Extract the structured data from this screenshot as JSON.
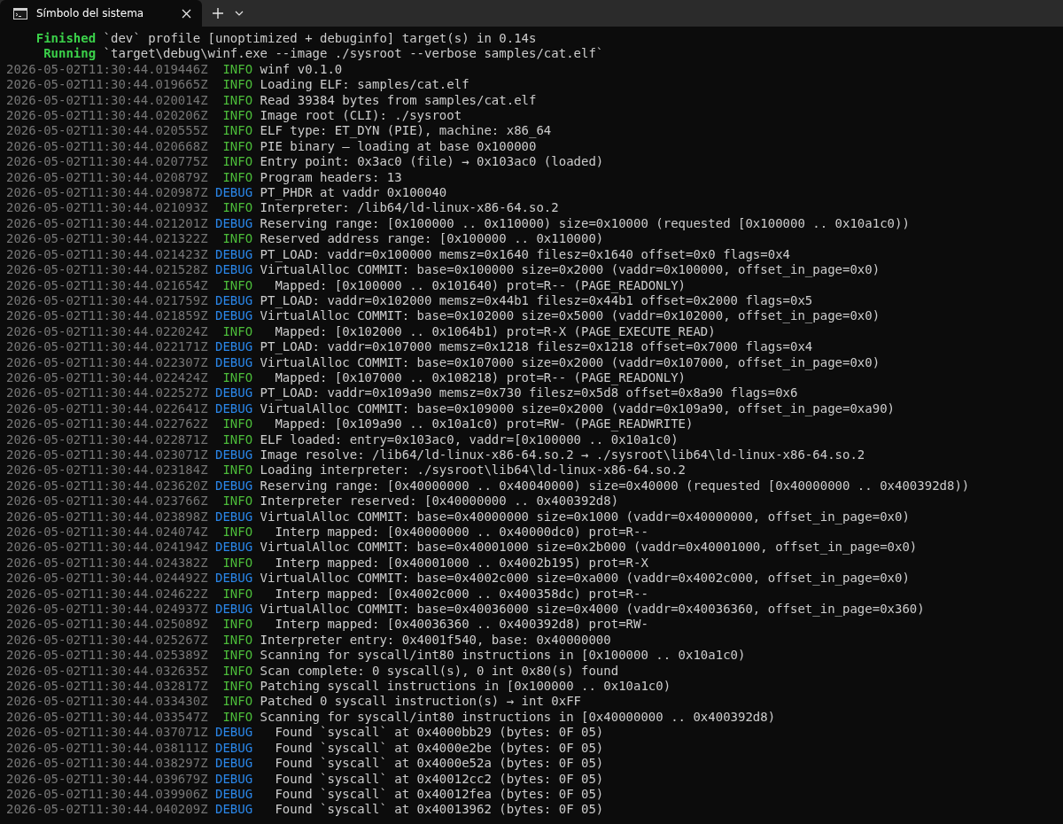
{
  "tabs": [
    {
      "title": "Símbolo del sistema",
      "selected": true
    }
  ],
  "cargo_lines": [
    {
      "status": "Finished",
      "message": "`dev` profile [unoptimized + debuginfo] target(s) in 0.14s"
    },
    {
      "status": "Running",
      "message": "`target\\debug\\winf.exe --image ./sysroot --verbose samples/cat.elf`"
    }
  ],
  "log_lines": [
    {
      "time": "2026-05-02T11:30:44.019446Z",
      "kind": "info",
      "severity": "INFO",
      "message": "winf v0.1.0"
    },
    {
      "time": "2026-05-02T11:30:44.019665Z",
      "kind": "info",
      "severity": "INFO",
      "message": "Loading ELF: samples/cat.elf"
    },
    {
      "time": "2026-05-02T11:30:44.020014Z",
      "kind": "info",
      "severity": "INFO",
      "message": "Read 39384 bytes from samples/cat.elf"
    },
    {
      "time": "2026-05-02T11:30:44.020206Z",
      "kind": "info",
      "severity": "INFO",
      "message": "Image root (CLI): ./sysroot"
    },
    {
      "time": "2026-05-02T11:30:44.020555Z",
      "kind": "info",
      "severity": "INFO",
      "message": "ELF type: ET_DYN (PIE), machine: x86_64"
    },
    {
      "time": "2026-05-02T11:30:44.020668Z",
      "kind": "info",
      "severity": "INFO",
      "message": "PIE binary – loading at base 0x100000"
    },
    {
      "time": "2026-05-02T11:30:44.020775Z",
      "kind": "info",
      "severity": "INFO",
      "message": "Entry point: 0x3ac0 (file) → 0x103ac0 (loaded)"
    },
    {
      "time": "2026-05-02T11:30:44.020879Z",
      "kind": "info",
      "severity": "INFO",
      "message": "Program headers: 13"
    },
    {
      "time": "2026-05-02T11:30:44.020987Z",
      "kind": "debug",
      "severity": "DEBUG",
      "message": "PT_PHDR at vaddr 0x100040"
    },
    {
      "time": "2026-05-02T11:30:44.021093Z",
      "kind": "info",
      "severity": "INFO",
      "message": "Interpreter: /lib64/ld-linux-x86-64.so.2"
    },
    {
      "time": "2026-05-02T11:30:44.021201Z",
      "kind": "debug",
      "severity": "DEBUG",
      "message": "Reserving range: [0x100000 .. 0x110000) size=0x10000 (requested [0x100000 .. 0x10a1c0))"
    },
    {
      "time": "2026-05-02T11:30:44.021322Z",
      "kind": "info",
      "severity": "INFO",
      "message": "Reserved address range: [0x100000 .. 0x110000)"
    },
    {
      "time": "2026-05-02T11:30:44.021423Z",
      "kind": "debug",
      "severity": "DEBUG",
      "message": "PT_LOAD: vaddr=0x100000 memsz=0x1640 filesz=0x1640 offset=0x0 flags=0x4"
    },
    {
      "time": "2026-05-02T11:30:44.021528Z",
      "kind": "debug",
      "severity": "DEBUG",
      "message": "VirtualAlloc COMMIT: base=0x100000 size=0x2000 (vaddr=0x100000, offset_in_page=0x0)"
    },
    {
      "time": "2026-05-02T11:30:44.021654Z",
      "kind": "info",
      "severity": "INFO",
      "message": "  Mapped: [0x100000 .. 0x101640) prot=R-- (PAGE_READONLY)"
    },
    {
      "time": "2026-05-02T11:30:44.021759Z",
      "kind": "debug",
      "severity": "DEBUG",
      "message": "PT_LOAD: vaddr=0x102000 memsz=0x44b1 filesz=0x44b1 offset=0x2000 flags=0x5"
    },
    {
      "time": "2026-05-02T11:30:44.021859Z",
      "kind": "debug",
      "severity": "DEBUG",
      "message": "VirtualAlloc COMMIT: base=0x102000 size=0x5000 (vaddr=0x102000, offset_in_page=0x0)"
    },
    {
      "time": "2026-05-02T11:30:44.022024Z",
      "kind": "info",
      "severity": "INFO",
      "message": "  Mapped: [0x102000 .. 0x1064b1) prot=R-X (PAGE_EXECUTE_READ)"
    },
    {
      "time": "2026-05-02T11:30:44.022171Z",
      "kind": "debug",
      "severity": "DEBUG",
      "message": "PT_LOAD: vaddr=0x107000 memsz=0x1218 filesz=0x1218 offset=0x7000 flags=0x4"
    },
    {
      "time": "2026-05-02T11:30:44.022307Z",
      "kind": "debug",
      "severity": "DEBUG",
      "message": "VirtualAlloc COMMIT: base=0x107000 size=0x2000 (vaddr=0x107000, offset_in_page=0x0)"
    },
    {
      "time": "2026-05-02T11:30:44.022424Z",
      "kind": "info",
      "severity": "INFO",
      "message": "  Mapped: [0x107000 .. 0x108218) prot=R-- (PAGE_READONLY)"
    },
    {
      "time": "2026-05-02T11:30:44.022527Z",
      "kind": "debug",
      "severity": "DEBUG",
      "message": "PT_LOAD: vaddr=0x109a90 memsz=0x730 filesz=0x5d8 offset=0x8a90 flags=0x6"
    },
    {
      "time": "2026-05-02T11:30:44.022641Z",
      "kind": "debug",
      "severity": "DEBUG",
      "message": "VirtualAlloc COMMIT: base=0x109000 size=0x2000 (vaddr=0x109a90, offset_in_page=0xa90)"
    },
    {
      "time": "2026-05-02T11:30:44.022762Z",
      "kind": "info",
      "severity": "INFO",
      "message": "  Mapped: [0x109a90 .. 0x10a1c0) prot=RW- (PAGE_READWRITE)"
    },
    {
      "time": "2026-05-02T11:30:44.022871Z",
      "kind": "info",
      "severity": "INFO",
      "message": "ELF loaded: entry=0x103ac0, vaddr=[0x100000 .. 0x10a1c0)"
    },
    {
      "time": "2026-05-02T11:30:44.023071Z",
      "kind": "debug",
      "severity": "DEBUG",
      "message": "Image resolve: /lib64/ld-linux-x86-64.so.2 → ./sysroot\\lib64\\ld-linux-x86-64.so.2"
    },
    {
      "time": "2026-05-02T11:30:44.023184Z",
      "kind": "info",
      "severity": "INFO",
      "message": "Loading interpreter: ./sysroot\\lib64\\ld-linux-x86-64.so.2"
    },
    {
      "time": "2026-05-02T11:30:44.023620Z",
      "kind": "debug",
      "severity": "DEBUG",
      "message": "Reserving range: [0x40000000 .. 0x40040000) size=0x40000 (requested [0x40000000 .. 0x400392d8))"
    },
    {
      "time": "2026-05-02T11:30:44.023766Z",
      "kind": "info",
      "severity": "INFO",
      "message": "Interpreter reserved: [0x40000000 .. 0x400392d8)"
    },
    {
      "time": "2026-05-02T11:30:44.023898Z",
      "kind": "debug",
      "severity": "DEBUG",
      "message": "VirtualAlloc COMMIT: base=0x40000000 size=0x1000 (vaddr=0x40000000, offset_in_page=0x0)"
    },
    {
      "time": "2026-05-02T11:30:44.024074Z",
      "kind": "info",
      "severity": "INFO",
      "message": "  Interp mapped: [0x40000000 .. 0x40000dc0) prot=R--"
    },
    {
      "time": "2026-05-02T11:30:44.024194Z",
      "kind": "debug",
      "severity": "DEBUG",
      "message": "VirtualAlloc COMMIT: base=0x40001000 size=0x2b000 (vaddr=0x40001000, offset_in_page=0x0)"
    },
    {
      "time": "2026-05-02T11:30:44.024382Z",
      "kind": "info",
      "severity": "INFO",
      "message": "  Interp mapped: [0x40001000 .. 0x4002b195) prot=R-X"
    },
    {
      "time": "2026-05-02T11:30:44.024492Z",
      "kind": "debug",
      "severity": "DEBUG",
      "message": "VirtualAlloc COMMIT: base=0x4002c000 size=0xa000 (vaddr=0x4002c000, offset_in_page=0x0)"
    },
    {
      "time": "2026-05-02T11:30:44.024622Z",
      "kind": "info",
      "severity": "INFO",
      "message": "  Interp mapped: [0x4002c000 .. 0x400358dc) prot=R--"
    },
    {
      "time": "2026-05-02T11:30:44.024937Z",
      "kind": "debug",
      "severity": "DEBUG",
      "message": "VirtualAlloc COMMIT: base=0x40036000 size=0x4000 (vaddr=0x40036360, offset_in_page=0x360)"
    },
    {
      "time": "2026-05-02T11:30:44.025089Z",
      "kind": "info",
      "severity": "INFO",
      "message": "  Interp mapped: [0x40036360 .. 0x400392d8) prot=RW-"
    },
    {
      "time": "2026-05-02T11:30:44.025267Z",
      "kind": "info",
      "severity": "INFO",
      "message": "Interpreter entry: 0x4001f540, base: 0x40000000"
    },
    {
      "time": "2026-05-02T11:30:44.025389Z",
      "kind": "info",
      "severity": "INFO",
      "message": "Scanning for syscall/int80 instructions in [0x100000 .. 0x10a1c0)"
    },
    {
      "time": "2026-05-02T11:30:44.032635Z",
      "kind": "info",
      "severity": "INFO",
      "message": "Scan complete: 0 syscall(s), 0 int 0x80(s) found"
    },
    {
      "time": "2026-05-02T11:30:44.032817Z",
      "kind": "info",
      "severity": "INFO",
      "message": "Patching syscall instructions in [0x100000 .. 0x10a1c0)"
    },
    {
      "time": "2026-05-02T11:30:44.033430Z",
      "kind": "info",
      "severity": "INFO",
      "message": "Patched 0 syscall instruction(s) → int 0xFF"
    },
    {
      "time": "2026-05-02T11:30:44.033547Z",
      "kind": "info",
      "severity": "INFO",
      "message": "Scanning for syscall/int80 instructions in [0x40000000 .. 0x400392d8)"
    },
    {
      "time": "2026-05-02T11:30:44.037071Z",
      "kind": "debug",
      "severity": "DEBUG",
      "message": "  Found `syscall` at 0x4000bb29 (bytes: 0F 05)"
    },
    {
      "time": "2026-05-02T11:30:44.038111Z",
      "kind": "debug",
      "severity": "DEBUG",
      "message": "  Found `syscall` at 0x4000e2be (bytes: 0F 05)"
    },
    {
      "time": "2026-05-02T11:30:44.038297Z",
      "kind": "debug",
      "severity": "DEBUG",
      "message": "  Found `syscall` at 0x4000e52a (bytes: 0F 05)"
    },
    {
      "time": "2026-05-02T11:30:44.039679Z",
      "kind": "debug",
      "severity": "DEBUG",
      "message": "  Found `syscall` at 0x40012cc2 (bytes: 0F 05)"
    },
    {
      "time": "2026-05-02T11:30:44.039906Z",
      "kind": "debug",
      "severity": "DEBUG",
      "message": "  Found `syscall` at 0x40012fea (bytes: 0F 05)"
    },
    {
      "time": "2026-05-02T11:30:44.040209Z",
      "kind": "debug",
      "severity": "DEBUG",
      "message": "  Found `syscall` at 0x40013962 (bytes: 0F 05)"
    }
  ]
}
